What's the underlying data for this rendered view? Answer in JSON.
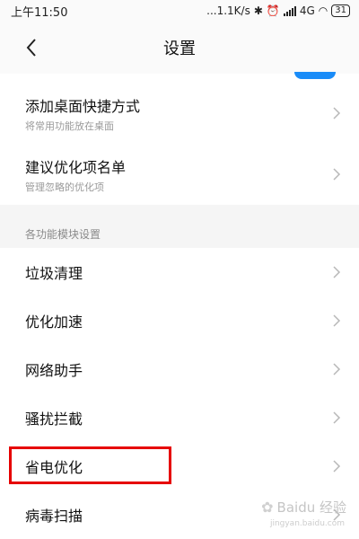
{
  "status_bar": {
    "time": "上午11:50",
    "speed": "...1.1K/s",
    "network": "4G",
    "battery": "31"
  },
  "header": {
    "title": "设置"
  },
  "top_items": [
    {
      "title": "添加桌面快捷方式",
      "subtitle": "将常用功能放在桌面"
    },
    {
      "title": "建议优化项名单",
      "subtitle": "管理忽略的优化项"
    }
  ],
  "section_label": "各功能模块设置",
  "module_items": [
    {
      "title": "垃圾清理"
    },
    {
      "title": "优化加速"
    },
    {
      "title": "网络助手"
    },
    {
      "title": "骚扰拦截"
    },
    {
      "title": "省电优化"
    },
    {
      "title": "病毒扫描"
    }
  ],
  "watermark": {
    "text": "Baidu 经验",
    "sub": "jingyan.baidu.com"
  },
  "colors": {
    "highlight": "#e60000",
    "toggle": "#1a8cf8"
  }
}
